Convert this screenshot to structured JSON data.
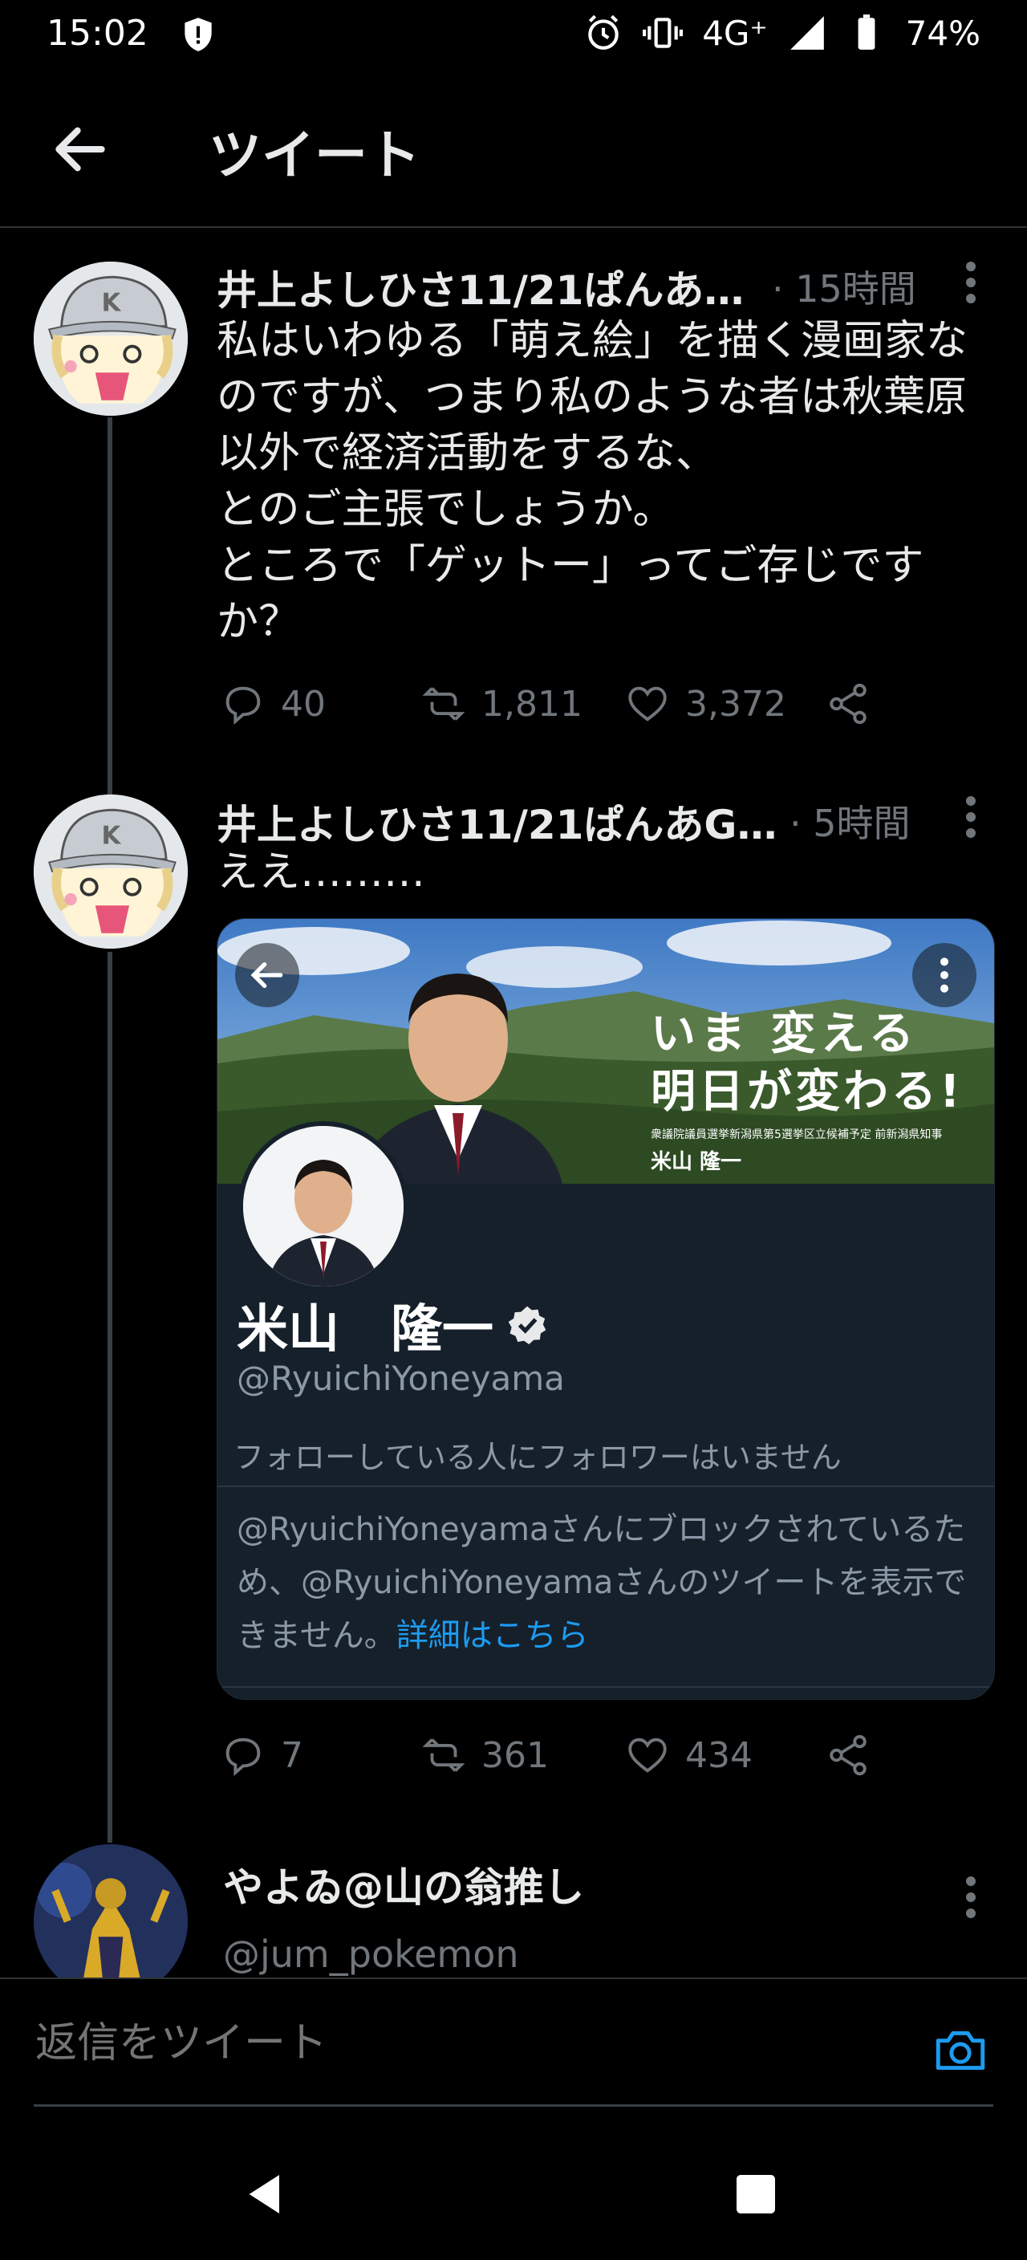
{
  "status_bar": {
    "time": "15:02",
    "network": "4G⁺",
    "battery": "74%"
  },
  "header": {
    "title": "ツイート"
  },
  "tweets": [
    {
      "author": "井上よしひさ11/21ぱんあ…",
      "time": "· 15時間",
      "text": "私はいわゆる「萌え絵」を描く漫画家なのですが、つまり私のような者は秋葉原以外で経済活動をするな、\nとのご主張でしょうか。\nところで「ゲットー」ってご存じですか？",
      "replies": "40",
      "retweets": "1,811",
      "likes": "3,372"
    },
    {
      "author": "井上よしひさ11/21ぱんあG…",
      "time": "· 5時間",
      "text": "ええ………",
      "replies": "7",
      "retweets": "361",
      "likes": "434"
    }
  ],
  "embedded_profile": {
    "banner_line1": "いま 変える",
    "banner_line2": "明日が変わる!",
    "banner_caption": "衆議院議員選挙新潟県第5選挙区立候補予定 前新潟県知事",
    "banner_name": "米山 隆一",
    "name": "米山　隆一",
    "handle": "@RyuichiYoneyama",
    "followers_note": "フォローしている人にフォロワーはいません",
    "blocked_text": "@RyuichiYoneyamaさんにブロックされているため、@RyuichiYoneyamaさんのツイートを表示できません。",
    "details_link": "詳細はこちら"
  },
  "next_reply": {
    "author": "やよゐ@山の翁推し",
    "handle": "@jum_pokemon"
  },
  "reply_bar": {
    "placeholder": "返信をツイート"
  },
  "colors": {
    "accent": "#1d9bf0",
    "background": "#000000",
    "card": "#15202b",
    "muted": "#71767b"
  }
}
